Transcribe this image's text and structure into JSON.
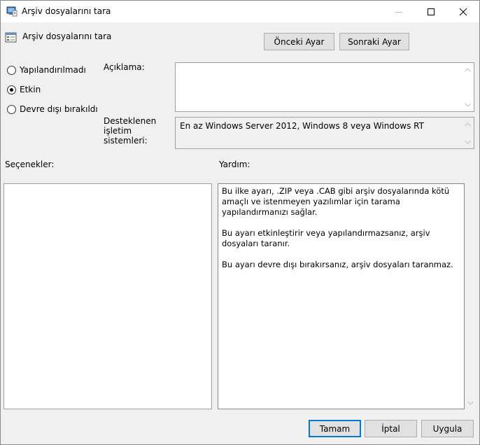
{
  "window": {
    "title": "Arşiv dosyalarını tara"
  },
  "header": {
    "title": "Arşiv dosyalarını tara",
    "prev_label": "Önceki Ayar",
    "next_label": "Sonraki Ayar"
  },
  "state": {
    "options": [
      {
        "label": "Yapılandırılmadı",
        "selected": false
      },
      {
        "label": "Etkin",
        "selected": true
      },
      {
        "label": "Devre dışı bırakıldı",
        "selected": false
      }
    ]
  },
  "fields": {
    "description_label": "Açıklama:",
    "description_value": "",
    "os_label": "Desteklenen işletim sistemleri:",
    "os_value": "En az Windows Server 2012, Windows 8 veya Windows RT"
  },
  "panels": {
    "options_label": "Seçenekler:",
    "help_label": "Yardım:",
    "help_paragraphs": [
      "Bu ilke ayarı, .ZIP veya .CAB gibi arşiv dosyalarında kötü amaçlı ve istenmeyen yazılımlar için tarama yapılandırmanızı sağlar.",
      "Bu ayarı etkinleştirir veya yapılandırmazsanız, arşiv dosyaları taranır.",
      "Bu ayarı devre dışı bırakırsanız, arşiv dosyaları taranmaz."
    ]
  },
  "footer": {
    "ok_label": "Tamam",
    "cancel_label": "İptal",
    "apply_label": "Uygula"
  },
  "colors": {
    "accent": "#0078d7",
    "button_face": "#e1e1e1",
    "dialog_bg": "#f0f0f0"
  }
}
